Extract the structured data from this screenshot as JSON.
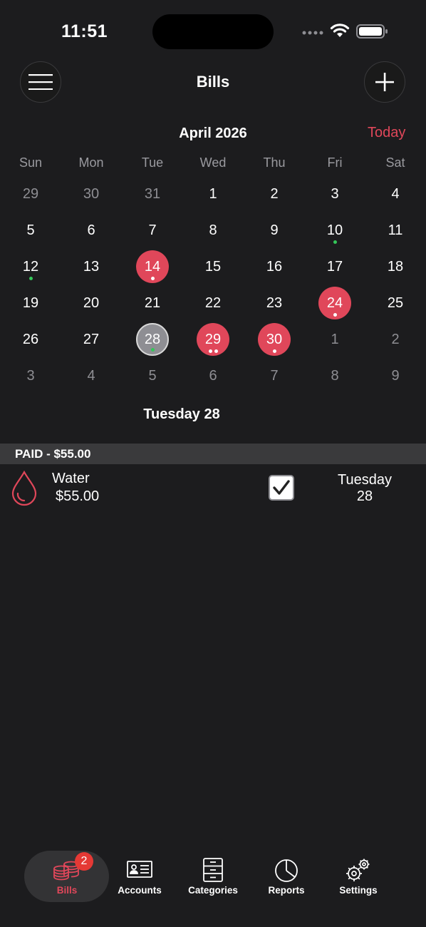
{
  "status_bar": {
    "time": "11:51"
  },
  "header": {
    "title": "Bills"
  },
  "calendar": {
    "month_label": "April 2026",
    "today_label": "Today",
    "weekdays": [
      "Sun",
      "Mon",
      "Tue",
      "Wed",
      "Thu",
      "Fri",
      "Sat"
    ],
    "weeks": [
      [
        {
          "d": "29",
          "dim": true
        },
        {
          "d": "30",
          "dim": true
        },
        {
          "d": "31",
          "dim": true
        },
        {
          "d": "1"
        },
        {
          "d": "2"
        },
        {
          "d": "3"
        },
        {
          "d": "4"
        }
      ],
      [
        {
          "d": "5"
        },
        {
          "d": "6"
        },
        {
          "d": "7"
        },
        {
          "d": "8"
        },
        {
          "d": "9"
        },
        {
          "d": "10",
          "dots": [
            "green"
          ]
        },
        {
          "d": "11"
        }
      ],
      [
        {
          "d": "12",
          "dots": [
            "green"
          ]
        },
        {
          "d": "13"
        },
        {
          "d": "14",
          "state": "due",
          "dots": [
            "white"
          ]
        },
        {
          "d": "15"
        },
        {
          "d": "16"
        },
        {
          "d": "17"
        },
        {
          "d": "18"
        }
      ],
      [
        {
          "d": "19"
        },
        {
          "d": "20"
        },
        {
          "d": "21"
        },
        {
          "d": "22"
        },
        {
          "d": "23"
        },
        {
          "d": "24",
          "state": "due",
          "dots": [
            "white"
          ]
        },
        {
          "d": "25"
        }
      ],
      [
        {
          "d": "26"
        },
        {
          "d": "27"
        },
        {
          "d": "28",
          "state": "selected",
          "dots": [
            "green"
          ]
        },
        {
          "d": "29",
          "state": "due",
          "dots": [
            "white",
            "white"
          ]
        },
        {
          "d": "30",
          "state": "due",
          "dots": [
            "white"
          ]
        },
        {
          "d": "1",
          "dim": true
        },
        {
          "d": "2",
          "dim": true
        }
      ],
      [
        {
          "d": "3",
          "dim": true
        },
        {
          "d": "4",
          "dim": true
        },
        {
          "d": "5",
          "dim": true
        },
        {
          "d": "6",
          "dim": true
        },
        {
          "d": "7",
          "dim": true
        },
        {
          "d": "8",
          "dim": true
        },
        {
          "d": "9",
          "dim": true
        }
      ]
    ],
    "selected_day_label": "Tuesday 28"
  },
  "section": {
    "label": "PAID - $55.00"
  },
  "bill": {
    "icon": "water-drop-icon",
    "name": "Water",
    "amount": "$55.00",
    "paid": true,
    "date_line1": "Tuesday",
    "date_line2": "28"
  },
  "tabs": [
    {
      "label": "Bills",
      "icon": "bills-coins-icon",
      "active": true,
      "badge": "2"
    },
    {
      "label": "Accounts",
      "icon": "accounts-card-icon"
    },
    {
      "label": "Categories",
      "icon": "categories-cabinet-icon"
    },
    {
      "label": "Reports",
      "icon": "reports-pie-icon"
    },
    {
      "label": "Settings",
      "icon": "settings-gears-icon"
    }
  ],
  "colors": {
    "accent": "#e0475a",
    "background": "#1c1c1e",
    "paid_dot": "#34c759",
    "badge": "#e53935"
  }
}
